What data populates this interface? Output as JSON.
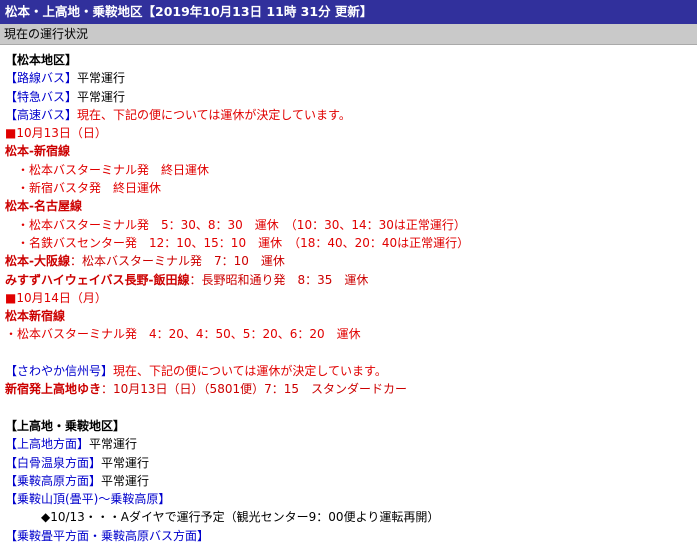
{
  "header": {
    "title": "松本・上高地・乗鞍地区【2019年10月13日 11時 31分 更新】"
  },
  "subheader": {
    "label": "現在の運行状況"
  },
  "matsumoto": {
    "heading": "【松本地区】",
    "route_bus": {
      "name": "【路線バス】",
      "status": "平常運行"
    },
    "express_bus": {
      "name": "【特急バス】",
      "status": "平常運行"
    },
    "highway_bus": {
      "name": "【高速バス】",
      "status": "現在、下記の便については運休が決定しています。"
    },
    "date1": "■10月13日（日）",
    "shinjuku_line": {
      "title": "松本-新宿線",
      "items": [
        "・松本バスターミナル発　終日運休",
        "・新宿バスタ発　終日運休"
      ]
    },
    "nagoya_line": {
      "title": "松本-名古屋線",
      "items": [
        "・松本バスターミナル発　5：30、8：30　運休　（10：30、14：30は正常運行）",
        "・名鉄バスセンター発　12：10、15：10　運休　（18：40、20：40は正常運行）"
      ]
    },
    "osaka_line": {
      "title": "松本-大阪線",
      "detail": "：松本バスターミナル発　7：10　運休"
    },
    "misuzu_line": {
      "title": "みすずハイウェイバス長野-飯田線",
      "detail": "：長野昭和通り発　8：35　運休"
    },
    "date2": "■10月14日（月）",
    "shinjuku_line2": {
      "title": "松本新宿線",
      "items": [
        "・松本バスターミナル発　4：20、4：50、5：20、6：20　運休"
      ]
    },
    "sawayaka": {
      "name": "【さわやか信州号】",
      "status": "現在、下記の便については運休が決定しています。"
    },
    "sawayaka_detail": {
      "title": "新宿発上高地ゆき",
      "detail": "：10月13日（日）（5801便）7：15　スタンダードカー"
    }
  },
  "kamikochi": {
    "heading": "【上高地・乗鞍地区】",
    "items": [
      {
        "name": "【上高地方面】",
        "status": "平常運行"
      },
      {
        "name": "【白骨温泉方面】",
        "status": "平常運行"
      },
      {
        "name": "【乗鞍高原方面】",
        "status": "平常運行"
      }
    ],
    "norikura_peak": {
      "name": "【乗鞍山頂(畳平)～乗鞍高原】"
    },
    "norikura_note": "◆10/13・・・Aダイヤで運行予定（観光センター9：00便より運転再開）",
    "cutoff_line": "【乗鞍畳平方面・乗鞍高原バス方面】"
  }
}
